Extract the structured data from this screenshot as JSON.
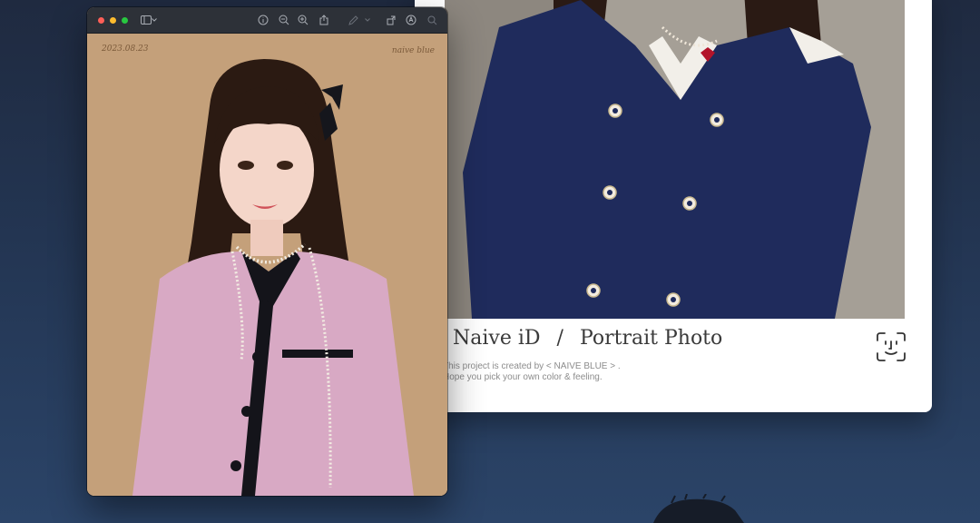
{
  "card": {
    "title_left": "Naive iD",
    "separator": "/",
    "title_right": "Portrait Photo",
    "credit_line_1": "This project is created by < NAIVE BLUE > .",
    "credit_line_2": "Hope you pick your own color & feeling."
  },
  "preview": {
    "photo_date_mark": "2023.08.23",
    "photo_brand_mark": "naive blue",
    "toolbar": {
      "icons": [
        "sidebar-icon",
        "chevron-down-icon",
        "info-icon",
        "zoom-out-icon",
        "zoom-in-icon",
        "share-icon",
        "markup-pen-icon",
        "chevron-down-icon",
        "rotate-icon",
        "annotate-icon",
        "search-icon"
      ]
    }
  },
  "colors": {
    "background": "#233552",
    "card": "#ffffff",
    "titlebar": "#2d3138",
    "photo_backdrop": "#c6a27b",
    "jacket_pink": "#d8a9c4",
    "coat_navy": "#1f2b5c"
  }
}
